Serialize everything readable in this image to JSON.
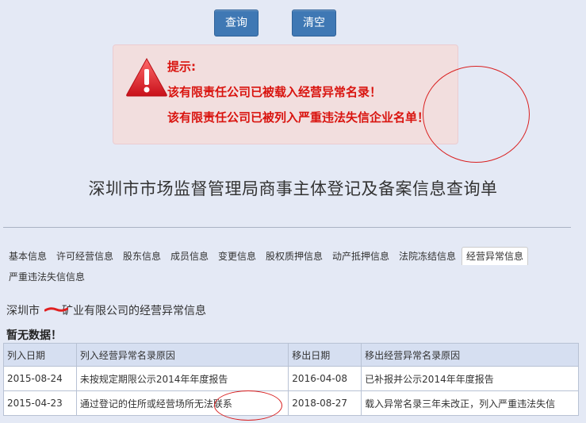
{
  "buttons": {
    "query": "查询",
    "clear": "清空"
  },
  "alert": {
    "title": "提示:",
    "lines": [
      "该有限责任公司已被载入经营异常名录！",
      "该有限责任公司已被列入严重违法失信企业名单！"
    ],
    "color": "#d9140f"
  },
  "page_title": "深圳市市场监督管理局商事主体登记及备案信息查询单",
  "tabs": [
    {
      "label": "基本信息"
    },
    {
      "label": "许可经营信息"
    },
    {
      "label": "股东信息"
    },
    {
      "label": "成员信息"
    },
    {
      "label": "变更信息"
    },
    {
      "label": "股权质押信息"
    },
    {
      "label": "动产抵押信息"
    },
    {
      "label": "法院冻结信息"
    },
    {
      "label": "经营异常信息",
      "active": true
    },
    {
      "label": "严重违法失信信息"
    }
  ],
  "section": {
    "title_prefix": "深圳市",
    "title_suffix": "矿业有限公司的经营异常信息",
    "no_data": "暂无数据！"
  },
  "table": {
    "headers": [
      "列入日期",
      "列入经营异常名录原因",
      "移出日期",
      "移出经营异常名录原因"
    ],
    "rows": [
      [
        "2015-08-24",
        "未按规定期限公示2014年年度报告",
        "2016-04-08",
        "已补报并公示2014年年度报告"
      ],
      [
        "2015-04-23",
        "通过登记的住所或经营场所无法联系",
        "2018-08-27",
        "载入异常名录三年未改正，列入严重违法失信"
      ]
    ]
  },
  "colors": {
    "background": "#e4e9f5",
    "button": "#3f78b4",
    "header": "#d6dff1",
    "annotation": "#d92020"
  }
}
